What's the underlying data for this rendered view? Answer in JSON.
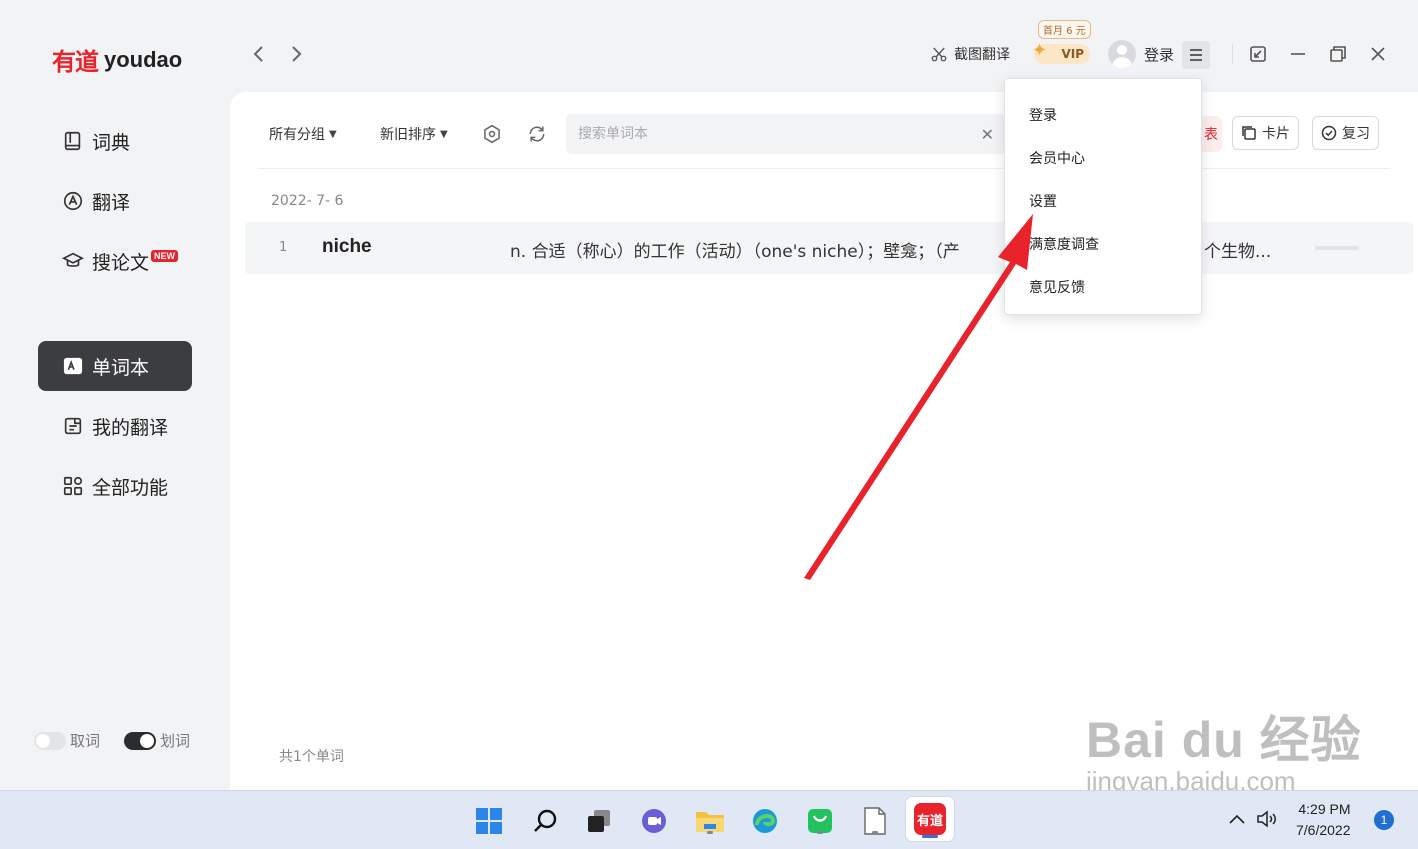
{
  "app": {
    "logo_cn": "有道",
    "logo_en": "youdao"
  },
  "sidebar": {
    "items": [
      {
        "label": "词典",
        "icon": "book-icon"
      },
      {
        "label": "翻译",
        "icon": "translate-icon"
      },
      {
        "label": "搜论文",
        "icon": "graduation-cap-icon",
        "badge": "NEW"
      },
      {
        "label": "单词本",
        "icon": "wordbook-icon",
        "active": true
      },
      {
        "label": "我的翻译",
        "icon": "my-translation-icon"
      },
      {
        "label": "全部功能",
        "icon": "grid-icon"
      }
    ],
    "toggles": [
      {
        "label": "取词",
        "on": false
      },
      {
        "label": "划词",
        "on": true
      }
    ]
  },
  "header": {
    "screenshot_translate": "截图翻译",
    "vip_promo": "首月 6 元",
    "vip_label": "VIP",
    "login": "登录"
  },
  "toolbar": {
    "group_select": "所有分组",
    "sort_select": "新旧排序",
    "search_placeholder": "搜索单词本",
    "list_btn_partial": "表",
    "card_btn": "卡片",
    "review_btn": "复习"
  },
  "wordlist": {
    "date": "2022- 7- 6",
    "rows": [
      {
        "index": "1",
        "word": "niche",
        "definition": "n. 合适（称心）的工作（活动）（one's niche）；壁龛；（产",
        "definition_tail": "个生物..."
      }
    ],
    "total": "共1个单词"
  },
  "dropdown_menu": {
    "items": [
      "登录",
      "会员中心",
      "设置",
      "满意度调查",
      "意见反馈"
    ]
  },
  "watermark": {
    "line1": "Bai du 经验",
    "line2": "jingyan.baidu.com"
  },
  "taskbar": {
    "time": "4:29 PM",
    "date": "7/6/2022",
    "notifications": "1",
    "app_label": "有道"
  },
  "colors": {
    "brand_red": "#e8232b",
    "active_nav": "#3c3d40",
    "arrow": "#e8232b"
  }
}
